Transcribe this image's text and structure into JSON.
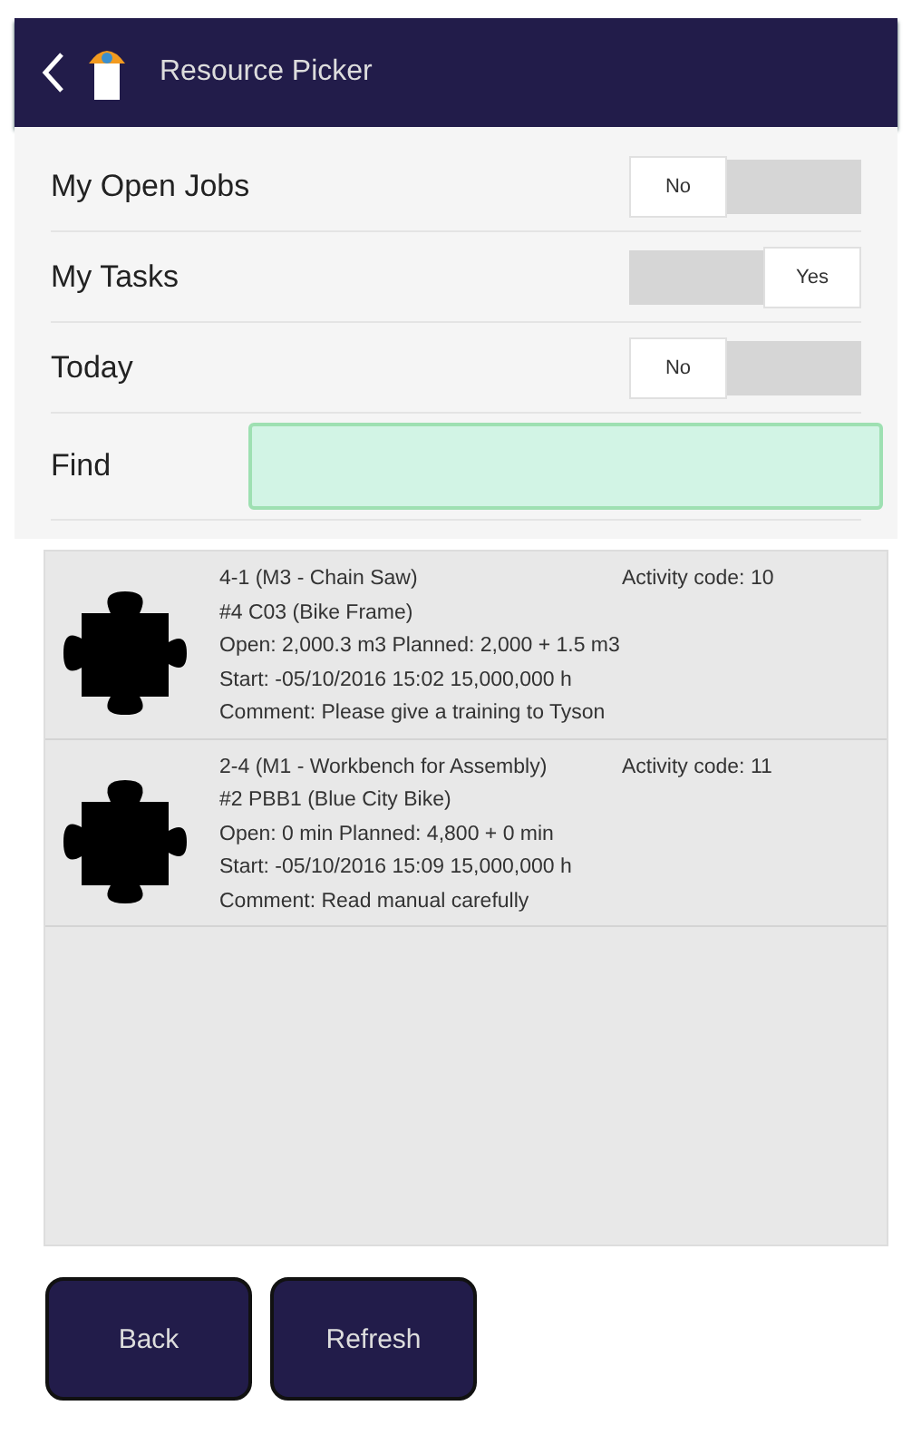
{
  "header": {
    "title": "Resource Picker"
  },
  "filters": [
    {
      "label": "My Open Jobs",
      "on": false,
      "toggle_text": "No"
    },
    {
      "label": "My Tasks",
      "on": true,
      "toggle_text": "Yes"
    },
    {
      "label": "Today",
      "on": false,
      "toggle_text": "No"
    }
  ],
  "find": {
    "label": "Find"
  },
  "jobs": [
    {
      "title": "4-1 (M3 - Chain Saw)",
      "activity_code": "Activity code: 10",
      "item": "#4 C03 (Bike Frame)",
      "quantities": "Open: 2,000.3 m3 Planned: 2,000 + 1.5 m3",
      "start": "Start: -05/10/2016 15:02 15,000,000 h",
      "comment": "Comment: Please give a training to Tyson"
    },
    {
      "title": "2-4 (M1 - Workbench for Assembly)",
      "activity_code": "Activity code: 11",
      "item": "#2 PBB1 (Blue City Bike)",
      "quantities": "Open: 0 min Planned: 4,800 + 0 min",
      "start": "Start: -05/10/2016 15:09 15,000,000 h",
      "comment": "Comment: Read manual carefully"
    }
  ],
  "buttons": [
    "Back",
    "Refresh"
  ]
}
